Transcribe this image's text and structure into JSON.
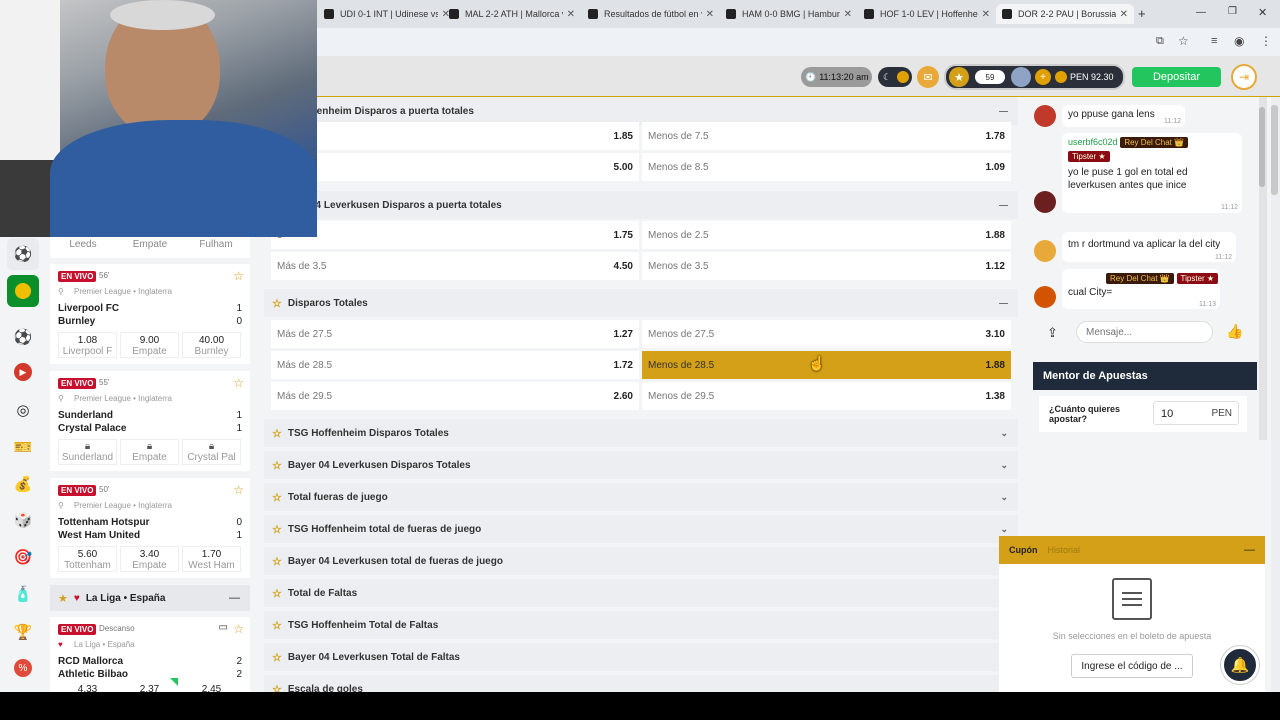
{
  "browser": {
    "tabs": [
      {
        "title": "UDI 0-1 INT | Udinese vs"
      },
      {
        "title": "MAL 2-2 ATH | Mallorca v"
      },
      {
        "title": "Resultados de fútbol en v"
      },
      {
        "title": "HAM 0-0 BMG | Hamburg"
      },
      {
        "title": "HOF 1-0 LEV | Hoffenheim"
      },
      {
        "title": "DOR 2-2 PAU | Borussia D"
      }
    ],
    "new_tab": "+"
  },
  "header": {
    "clock": "11:13:20 am",
    "level": "59",
    "balance": "PEN 92.30",
    "deposit_label": "Depositar"
  },
  "matches": {
    "top_names": [
      "Leeds",
      "Empate",
      "Fulham"
    ],
    "cards": [
      {
        "live": "EN VIVO",
        "minute": "56'",
        "league": "Premier League • Inglaterra",
        "home": "Liverpool FC",
        "away": "Burnley",
        "home_score": "1",
        "away_score": "0",
        "odds": [
          {
            "v": "1.08",
            "l": "Liverpool F"
          },
          {
            "v": "9.00",
            "l": "Empate"
          },
          {
            "v": "40.00",
            "l": "Burnley"
          }
        ]
      },
      {
        "live": "EN VIVO",
        "minute": "55'",
        "league": "Premier League • Inglaterra",
        "home": "Sunderland",
        "away": "Crystal Palace",
        "home_score": "1",
        "away_score": "1",
        "odds": [
          {
            "v": "",
            "l": "Sunderland"
          },
          {
            "v": "",
            "l": "Empate"
          },
          {
            "v": "",
            "l": "Crystal Pal"
          }
        ]
      },
      {
        "live": "EN VIVO",
        "minute": "50'",
        "league": "Premier League • Inglaterra",
        "home": "Tottenham Hotspur",
        "away": "West Ham United",
        "home_score": "0",
        "away_score": "1",
        "odds": [
          {
            "v": "5.60",
            "l": "Tottenham"
          },
          {
            "v": "3.40",
            "l": "Empate"
          },
          {
            "v": "1.70",
            "l": "West Ham"
          }
        ]
      }
    ],
    "laliga_header": "La Liga • España",
    "laliga_card": {
      "live": "EN VIVO",
      "status": "Descanso",
      "league": "La Liga • España",
      "home": "RCD Mallorca",
      "away": "Athletic Bilbao",
      "home_score": "2",
      "away_score": "2",
      "odds": [
        "4.33",
        "2.37",
        "2.45"
      ]
    }
  },
  "markets": {
    "hof_header": "ffenheim Disparos a puerta totales",
    "hof_rows": [
      {
        "l": "5",
        "lv": "1.85",
        "r": "Menos de 7.5",
        "rv": "1.78"
      },
      {
        "l": "5",
        "lv": "5.00",
        "r": "Menos de 8.5",
        "rv": "1.09"
      }
    ],
    "lev_header": "04 Leverkusen Disparos a puerta totales",
    "lev_rows": [
      {
        "l": "5",
        "lv": "1.75",
        "r": "Menos de 2.5",
        "rv": "1.88"
      },
      {
        "l": "Más de 3.5",
        "lv": "4.50",
        "r": "Menos de 3.5",
        "rv": "1.12"
      }
    ],
    "tot_header": "Disparos Totales",
    "tot_rows": [
      {
        "l": "Más de 27.5",
        "lv": "1.27",
        "r": "Menos de 27.5",
        "rv": "3.10"
      },
      {
        "l": "Más de 28.5",
        "lv": "1.72",
        "r": "Menos de 28.5",
        "rv": "1.88"
      },
      {
        "l": "Más de 29.5",
        "lv": "2.60",
        "r": "Menos de 29.5",
        "rv": "1.38"
      }
    ],
    "collapsed": [
      "TSG Hoffenheim Disparos Totales",
      "Bayer 04 Leverkusen Disparos Totales",
      "Total fueras de juego",
      "TSG Hoffenheim total de fueras de juego",
      "Bayer 04 Leverkusen total de fueras de juego",
      "Total de Faltas",
      "TSG Hoffenheim Total de Faltas",
      "Bayer 04 Leverkusen Total de Faltas",
      "Escala de goles"
    ]
  },
  "chat": {
    "m1": {
      "text": "yo ppuse gana lens",
      "time": "11:12"
    },
    "m2": {
      "user": "userbf6c02d",
      "rey": "Rey Del Chat 👑",
      "tipster": "Tipster ★",
      "text": "yo le puse 1 gol en total ed leverkusen antes que inice",
      "time": "11:12"
    },
    "m3": {
      "text": "tm r dortmund va aplicar la del city",
      "time": "11:12"
    },
    "m4": {
      "rey": "Rey Del Chat 👑",
      "tipster": "Tipster ★",
      "text": "cual City=",
      "time": "11:13"
    },
    "input_placeholder": "Mensaje..."
  },
  "mentor": {
    "title": "Mentor de Apuestas",
    "question": "¿Cuánto quieres apostar?",
    "amount": "10",
    "currency": "PEN"
  },
  "cupon": {
    "tab_active": "Cupón",
    "tab_inactive": "Historial",
    "empty_text": "Sin selecciones en el boleto de apuesta",
    "code_button": "Ingrese el código de ..."
  },
  "colors": {
    "accent": "#d4a017",
    "live": "#c8102e",
    "deposit": "#22c55e",
    "mentor": "#1f2a3a"
  }
}
